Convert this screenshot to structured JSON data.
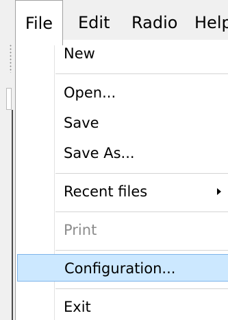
{
  "menubar": {
    "items": [
      {
        "label": "File"
      },
      {
        "label": "Edit"
      },
      {
        "label": "Radio"
      },
      {
        "label": "Help"
      }
    ]
  },
  "file_menu": {
    "new": "New",
    "open": "Open...",
    "save": "Save",
    "save_as": "Save As...",
    "recent_files": "Recent files",
    "print": "Print",
    "configuration": "Configuration...",
    "exit": "Exit"
  },
  "colors": {
    "highlight_bg": "#cce8ff",
    "highlight_border": "#7eb4ea",
    "disabled_text": "#8c8c8c"
  }
}
